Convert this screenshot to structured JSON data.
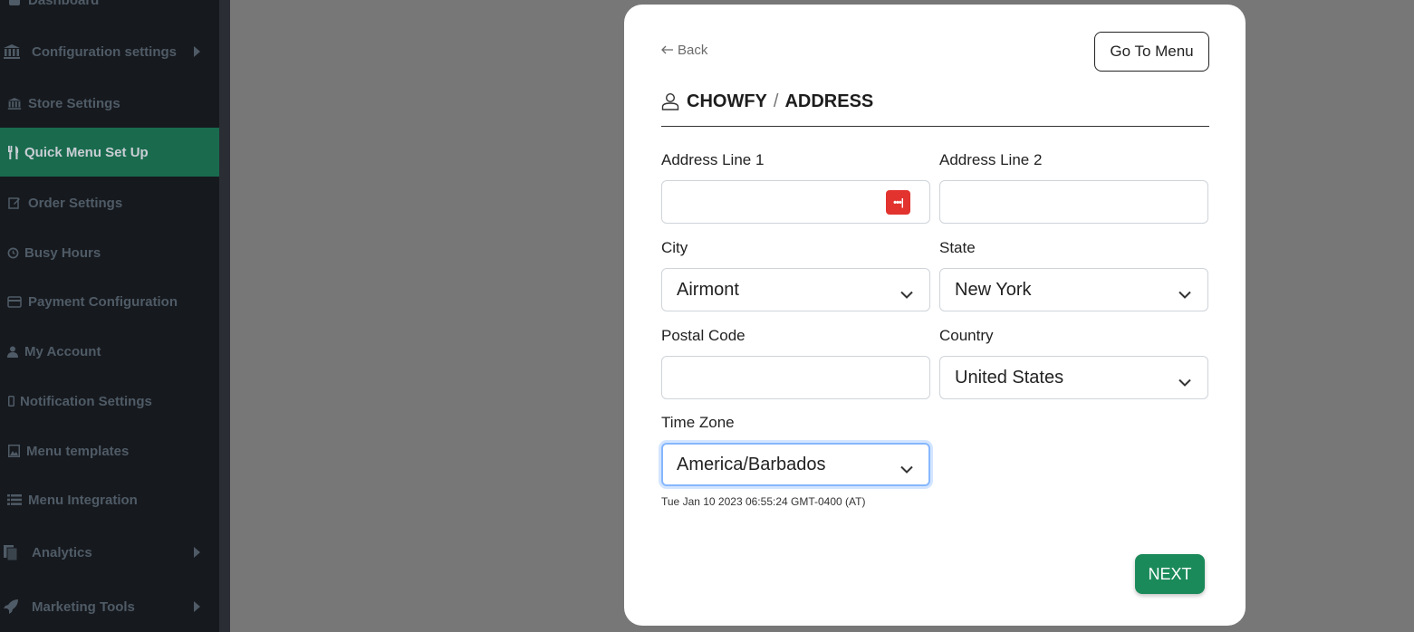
{
  "sidebar": {
    "items": [
      {
        "label": "Dashboard",
        "icon": "dashboard-icon"
      },
      {
        "label": "Configuration settings",
        "icon": "bank-icon",
        "has_submenu": true
      },
      {
        "label": "Store Settings",
        "icon": "bank-icon"
      },
      {
        "label": "Quick Menu Set Up",
        "icon": "fork-knife-icon",
        "active": true
      },
      {
        "label": "Order Settings",
        "icon": "edit-icon"
      },
      {
        "label": "Busy Hours",
        "icon": "clock-icon"
      },
      {
        "label": "Payment Configuration",
        "icon": "credit-card-icon"
      },
      {
        "label": "My Account",
        "icon": "user-icon"
      },
      {
        "label": "Notification Settings",
        "icon": "mobile-icon"
      },
      {
        "label": "Menu templates",
        "icon": "image-icon"
      },
      {
        "label": "Menu Integration",
        "icon": "list-icon"
      },
      {
        "label": "Analytics",
        "icon": "copy-icon",
        "has_submenu": true
      },
      {
        "label": "Marketing Tools",
        "icon": "rocket-icon",
        "has_submenu": true
      }
    ]
  },
  "modal": {
    "back_label": "Back",
    "go_to_menu_label": "Go To Menu",
    "breadcrumb": {
      "store": "CHOWFY",
      "separator": "/",
      "section": "ADDRESS"
    },
    "form": {
      "address_line1": {
        "label": "Address Line 1",
        "value": ""
      },
      "address_line2": {
        "label": "Address Line 2",
        "value": ""
      },
      "city": {
        "label": "City",
        "value": "Airmont"
      },
      "state": {
        "label": "State",
        "value": "New York"
      },
      "postal_code": {
        "label": "Postal Code",
        "value": ""
      },
      "country": {
        "label": "Country",
        "value": "United States"
      },
      "time_zone": {
        "label": "Time Zone",
        "value": "America/Barbados"
      }
    },
    "time_zone_current": "Tue Jan 10 2023 06:55:24 GMT-0400 (AT)",
    "next_label": "NEXT"
  },
  "colors": {
    "sidebar_bg": "#16191e",
    "sidebar_active": "#1a6b4e",
    "overlay": "#777777",
    "next_button": "#1b8a5a",
    "password_manager_icon": "#e2332f"
  }
}
